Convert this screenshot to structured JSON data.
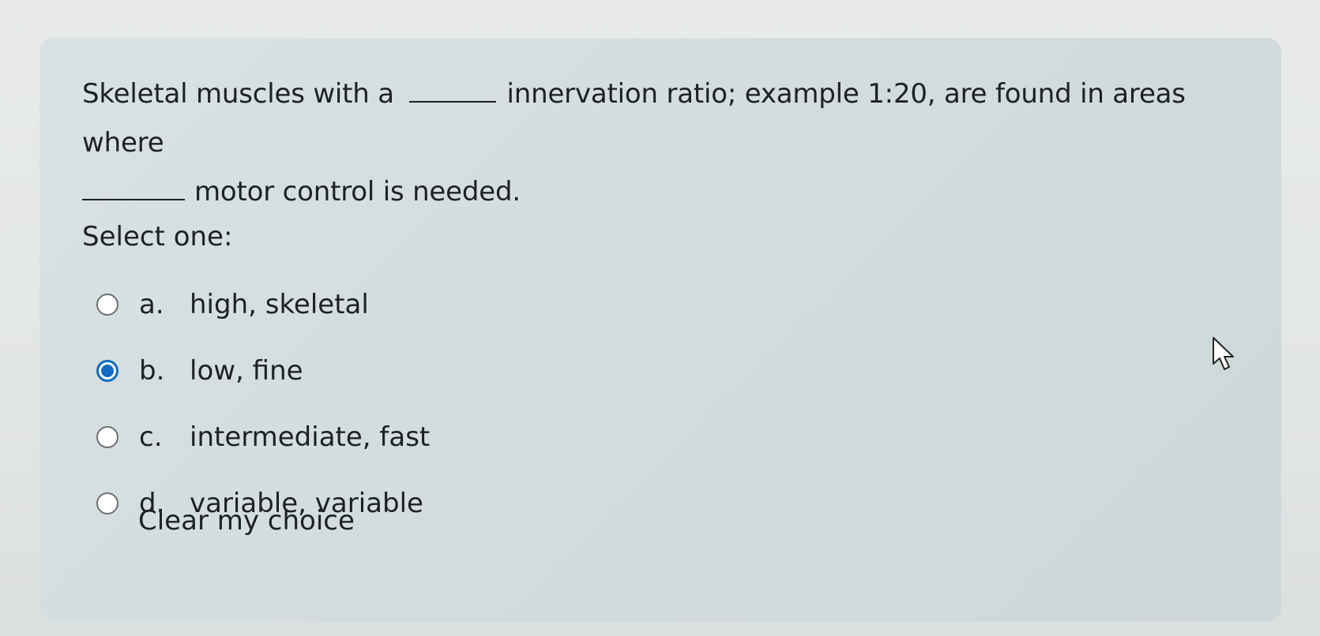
{
  "question": {
    "text_part1": "Skeletal muscles with a",
    "text_part2": "innervation ratio; example 1:20, are found in areas where",
    "text_part3": "motor control is needed.",
    "prompt": "Select one:"
  },
  "options": [
    {
      "letter": "a.",
      "text": "high, skeletal",
      "selected": false
    },
    {
      "letter": "b.",
      "text": "low, fine",
      "selected": true
    },
    {
      "letter": "c.",
      "text": "intermediate, fast",
      "selected": false
    },
    {
      "letter": "d.",
      "text": "variable, variable",
      "selected": false
    }
  ],
  "clear_choice_label": "Clear my choice",
  "colors": {
    "accent": "#0f6cbf",
    "card_background": "#d6dfe0",
    "text": "#1d2125"
  },
  "icons": {
    "pointer": "mouse-pointer-icon"
  }
}
